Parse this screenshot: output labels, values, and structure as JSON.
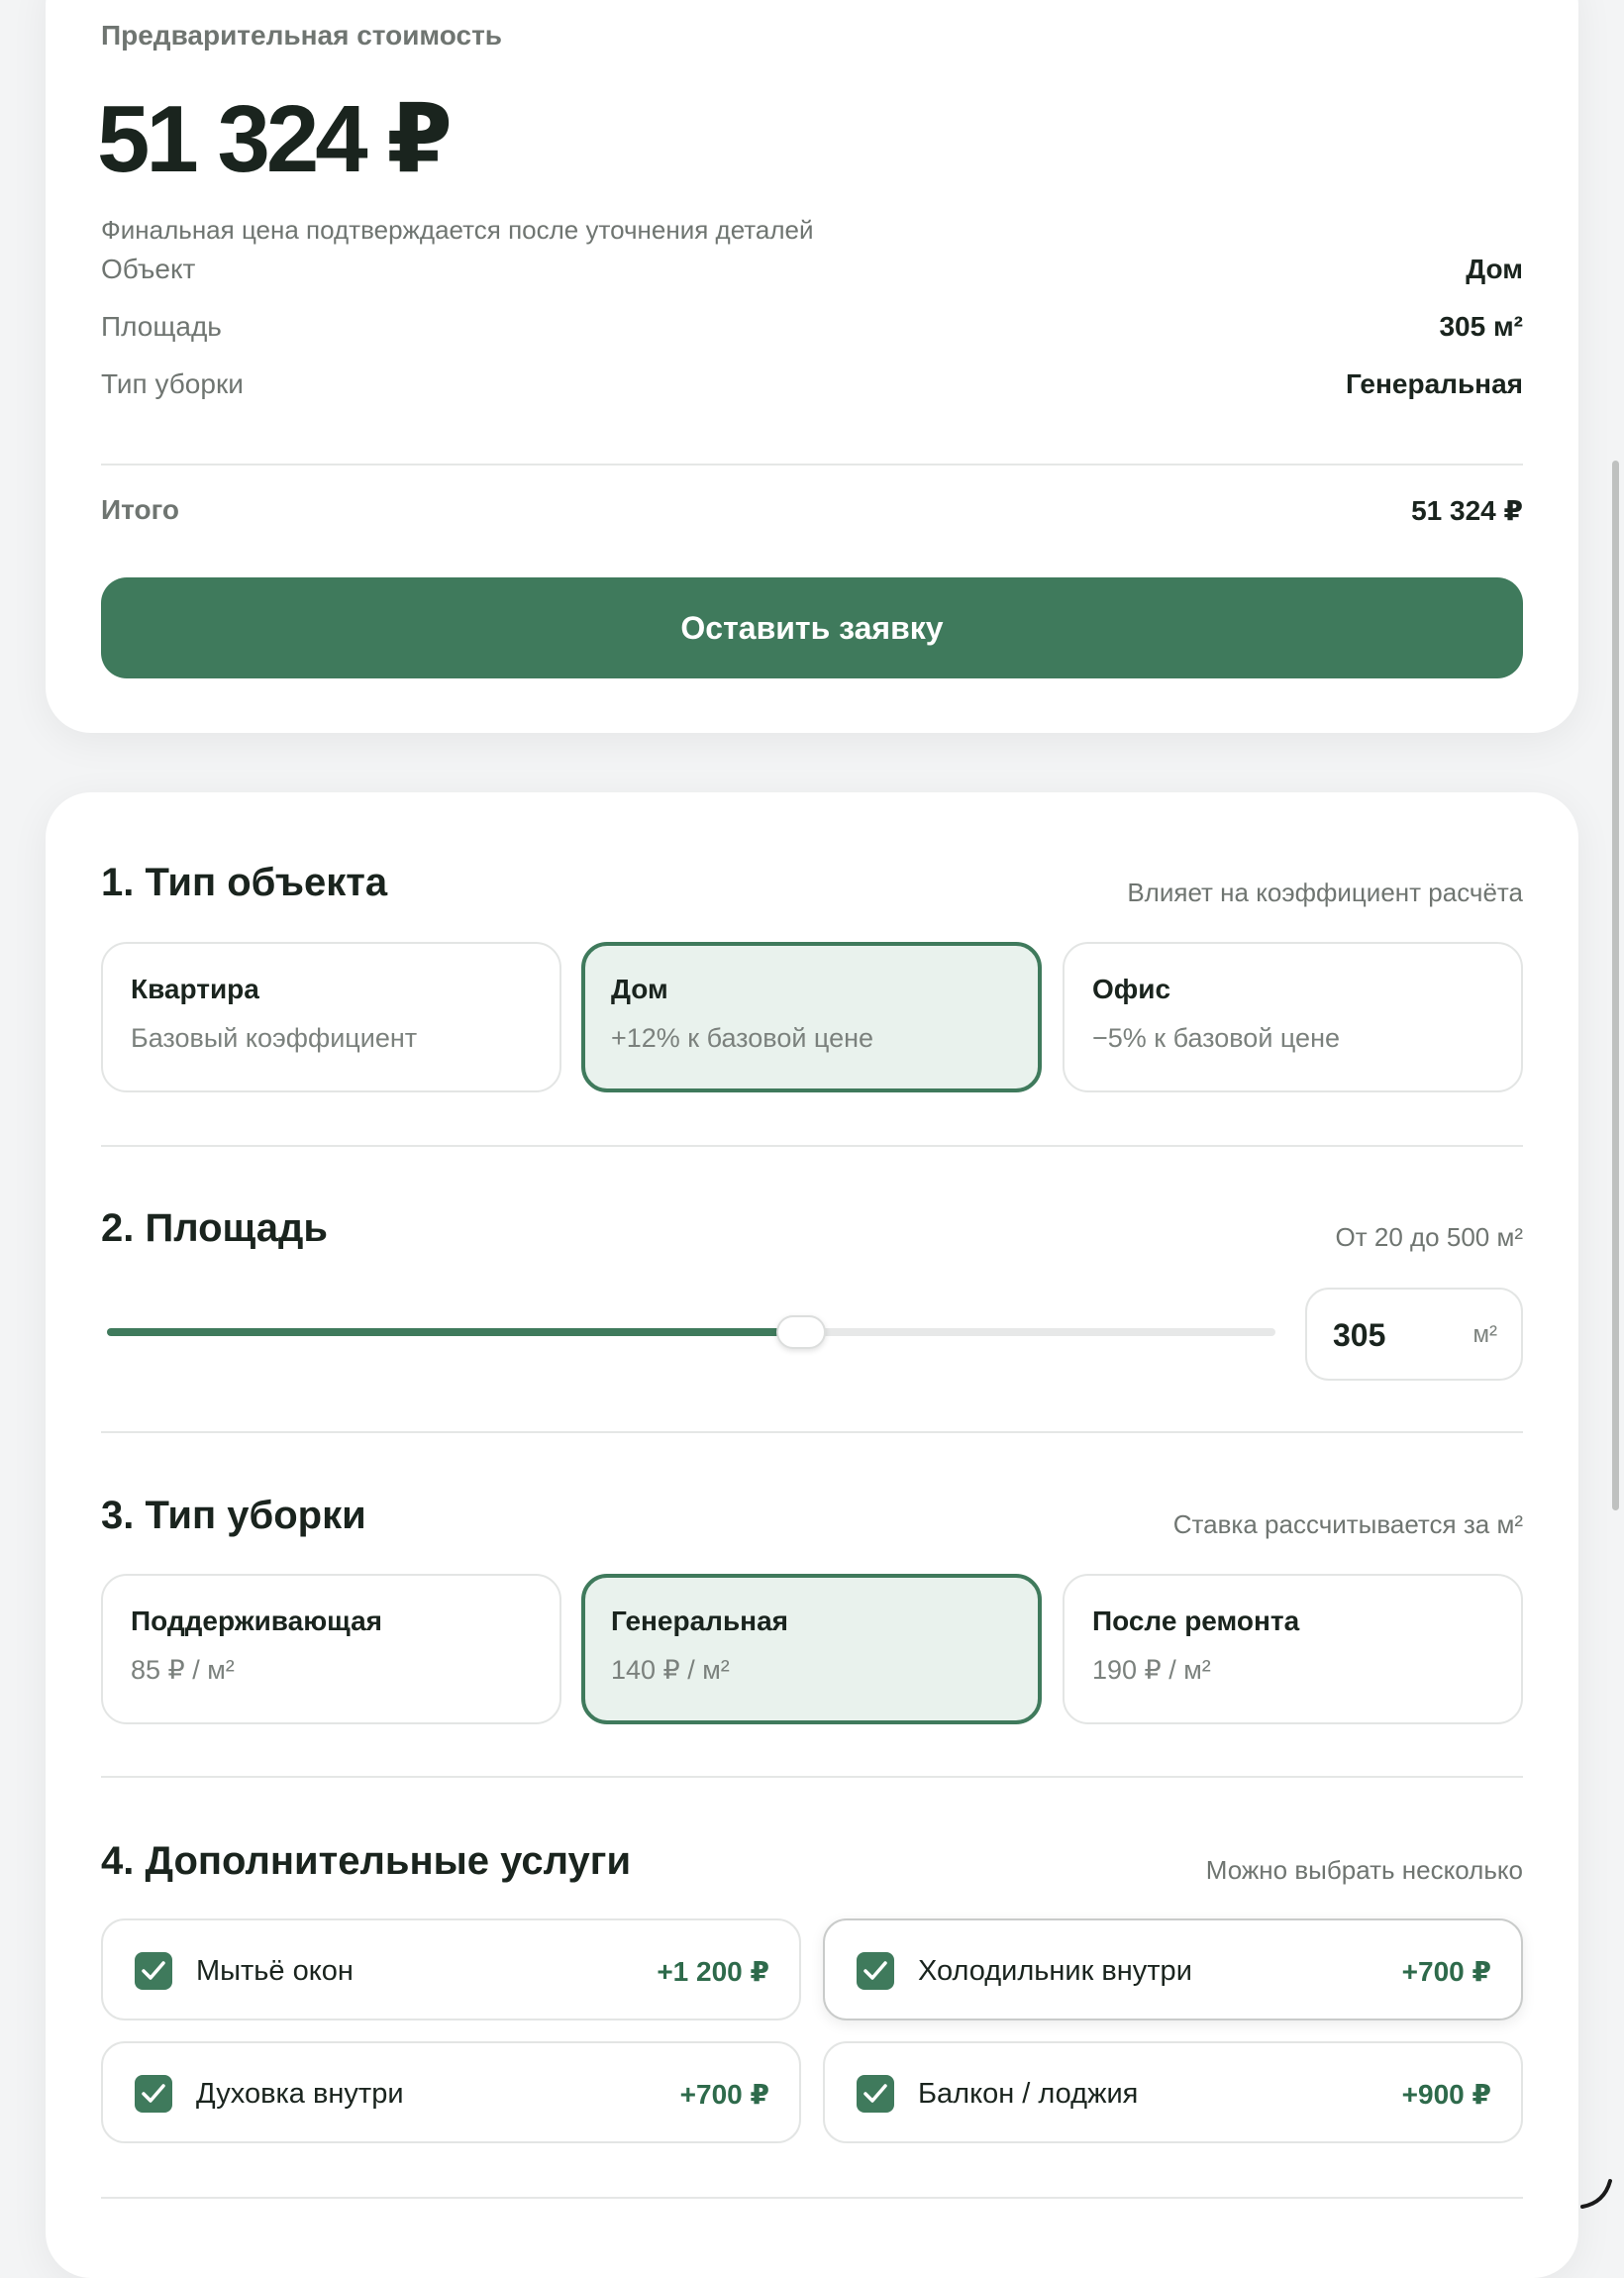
{
  "summary": {
    "label": "Предварительная стоимость",
    "price": "51 324 ₽",
    "note": "Финальная цена подтверждается после уточнения деталей",
    "rows": [
      {
        "label": "Объект",
        "value": "Дом"
      },
      {
        "label": "Площадь",
        "value": "305 м²"
      },
      {
        "label": "Тип уборки",
        "value": "Генеральная"
      }
    ],
    "total_label": "Итого",
    "total_value": "51 324 ₽",
    "cta_label": "Оставить заявку"
  },
  "object_type": {
    "title": "1. Тип объекта",
    "hint": "Влияет на коэффициент расчёта",
    "options": [
      {
        "title": "Квартира",
        "sub": "Базовый коэффициент",
        "selected": false
      },
      {
        "title": "Дом",
        "sub": "+12% к базовой цене",
        "selected": true
      },
      {
        "title": "Офис",
        "sub": "−5% к базовой цене",
        "selected": false
      }
    ]
  },
  "area": {
    "title": "2. Площадь",
    "hint": "От 20 до 500 м²",
    "min": 20,
    "max": 500,
    "value": 305,
    "value_text": "305",
    "unit": "м²"
  },
  "cleaning_type": {
    "title": "3. Тип уборки",
    "hint": "Ставка рассчитывается за м²",
    "options": [
      {
        "title": "Поддерживающая",
        "sub": "85 ₽ / м²",
        "selected": false
      },
      {
        "title": "Генеральная",
        "sub": "140 ₽ / м²",
        "selected": true
      },
      {
        "title": "После ремонта",
        "sub": "190 ₽ / м²",
        "selected": false
      }
    ]
  },
  "extras": {
    "title": "4. Дополнительные услуги",
    "hint": "Можно выбрать несколько",
    "items": [
      {
        "label": "Мытьё окон",
        "price": "+1 200 ₽",
        "checked": true
      },
      {
        "label": "Холодильник внутри",
        "price": "+700 ₽",
        "checked": true
      },
      {
        "label": "Духовка внутри",
        "price": "+700 ₽",
        "checked": true
      },
      {
        "label": "Балкон / лоджия",
        "price": "+900 ₽",
        "checked": true
      }
    ]
  },
  "colors": {
    "accent": "#3f7a5c",
    "selected_bg": "#e9f2ed",
    "page_bg": "#f3f4f5"
  }
}
